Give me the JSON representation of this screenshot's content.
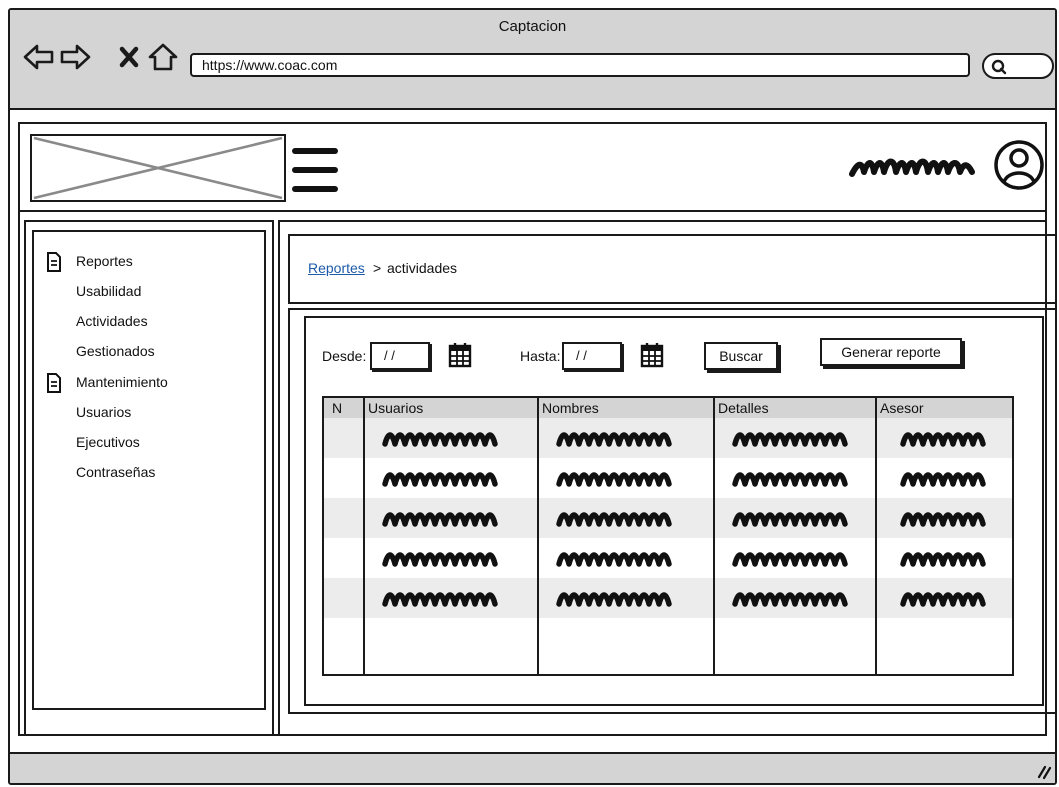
{
  "window": {
    "title": "Captacion"
  },
  "browser": {
    "url": "https://www.coac.com",
    "nav_icons": [
      "back-arrow-icon",
      "forward-arrow-icon",
      "close-x-icon",
      "home-icon"
    ],
    "search_icon": "search-icon"
  },
  "header": {
    "logo": "image-placeholder",
    "menu_icon": "hamburger-icon",
    "user_name": "scribble-placeholder",
    "avatar_icon": "user-circle-icon"
  },
  "sidebar": {
    "sections": [
      {
        "label": "Reportes",
        "icon": "document-icon",
        "items": [
          "Usabilidad",
          "Actividades",
          "Gestionados"
        ]
      },
      {
        "label": "Mantenimiento",
        "icon": "document-icon",
        "items": [
          "Usuarios",
          "Ejecutivos",
          "Contraseñas"
        ]
      }
    ]
  },
  "breadcrumb": {
    "link": "Reportes",
    "separator": ">",
    "current": "actividades"
  },
  "filters": {
    "desde_label": "Desde:",
    "desde_value": "/ /",
    "hasta_label": "Hasta:",
    "hasta_value": "/ /",
    "calendar_icon": "calendar-icon",
    "search_button": "Buscar",
    "report_button": "Generar reporte"
  },
  "table": {
    "columns": [
      "N",
      "Usuarios",
      "Nombres",
      "Detalles",
      "Asesor"
    ],
    "rows": 5,
    "cell_content": "scribble-placeholder",
    "row_colors": [
      "#ececec",
      "#ffffff"
    ],
    "header_color": "#d4d4d4"
  },
  "colors": {
    "chrome": "#d4d4d4",
    "stroke": "#1a1a1a",
    "link": "#1d5aa8"
  }
}
